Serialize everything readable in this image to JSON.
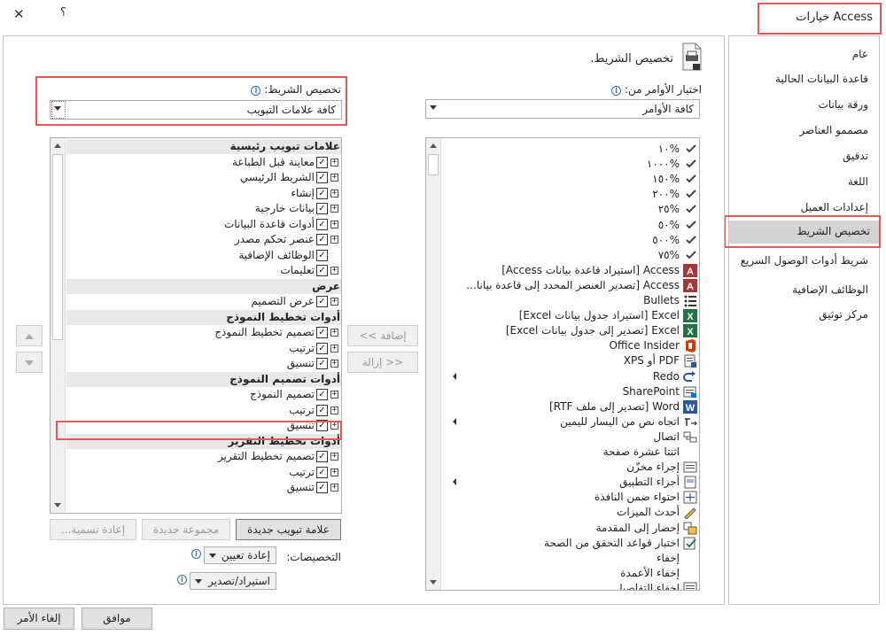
{
  "window": {
    "title": "خيارات Access",
    "help": "؟",
    "close": "✕"
  },
  "nav": {
    "items": [
      {
        "label": "عام"
      },
      {
        "label": "قاعدة البيانات الحالية"
      },
      {
        "label": "ورقة بيانات"
      },
      {
        "label": "مصممو العناصر"
      },
      {
        "label": "تدقيق"
      },
      {
        "label": "اللغة"
      },
      {
        "label": "إعدادات العميل"
      },
      {
        "label": "تخصيص الشريط"
      },
      {
        "label": "شريط أدوات الوصول السريع"
      },
      {
        "label": "الوظائف الإضافية"
      },
      {
        "label": "مركز توثيق"
      }
    ],
    "active_index": 7
  },
  "header": {
    "title": "تخصيص الشريط."
  },
  "commands": {
    "label": "اختيار الأوامر من:",
    "selected": "كافة الأوامر",
    "items": [
      {
        "text": "%١٠",
        "icon": "check-icon"
      },
      {
        "text": "%١٠٠٠",
        "icon": "check-icon"
      },
      {
        "text": "%١٥٠",
        "icon": "check-icon"
      },
      {
        "text": "%٢٠٠",
        "icon": "check-icon"
      },
      {
        "text": "%٢٥",
        "icon": "check-icon"
      },
      {
        "text": "%٥٠",
        "icon": "check-icon"
      },
      {
        "text": "%٥٠٠",
        "icon": "check-icon"
      },
      {
        "text": "%٧٥",
        "icon": "check-icon"
      },
      {
        "text": "Access [استيراد قاعدة بيانات Access]",
        "icon": "access-icon"
      },
      {
        "text": "Access [تصدير العنصر المحدد إلى قاعدة بيانا...",
        "icon": "access-icon"
      },
      {
        "text": "Bullets",
        "icon": "bullets-icon"
      },
      {
        "text": "Excel [استيراد جدول بيانات Excel]",
        "icon": "excel-icon"
      },
      {
        "text": "Excel [تصدير إلى جدول بيانات Excel]",
        "icon": "excel-icon"
      },
      {
        "text": "Office Insider",
        "icon": "office-icon"
      },
      {
        "text": "PDF أو XPS",
        "icon": "pdf-icon"
      },
      {
        "text": "Redo",
        "icon": "redo-icon",
        "submenu": true
      },
      {
        "text": "SharePoint",
        "icon": "sharepoint-icon"
      },
      {
        "text": "Word [تصدير إلى ملف RTF]",
        "icon": "word-icon"
      },
      {
        "text": "اتجاه نص من اليسار لليمين",
        "icon": "ltr-icon",
        "submenu": true
      },
      {
        "text": "اتصال",
        "icon": "connect-icon"
      },
      {
        "text": "اثنتا عشرة صفحة",
        "icon": ""
      },
      {
        "text": "إجراء مخزّن",
        "icon": "stored-proc-icon"
      },
      {
        "text": "أجزاء التطبيق",
        "icon": "app-parts-icon",
        "submenu": true
      },
      {
        "text": "احتواء ضمن النافذة",
        "icon": "fit-window-icon"
      },
      {
        "text": "أحدث الميزات",
        "icon": "new-features-icon"
      },
      {
        "text": "إحضار إلى المقدمة",
        "icon": "bring-front-icon"
      },
      {
        "text": "اختبار قواعد التحقق من الصحة",
        "icon": "validation-icon"
      },
      {
        "text": "إخفاء",
        "icon": ""
      },
      {
        "text": "إخفاء الأعمدة",
        "icon": ""
      },
      {
        "text": "إخفاء التفاصيل",
        "icon": "hide-details-icon"
      }
    ]
  },
  "ribbon": {
    "label": "تخصيص الشريط:",
    "selected": "كافة علامات التبويب",
    "items": [
      {
        "text": "علامات تبويب رئيسية",
        "type": "group"
      },
      {
        "text": "معاينة قبل الطباعة",
        "type": "tab",
        "expand": true
      },
      {
        "text": "الشريط الرئيسي",
        "type": "tab",
        "expand": true
      },
      {
        "text": "إنشاء",
        "type": "tab",
        "expand": true
      },
      {
        "text": "بيانات خارجية",
        "type": "tab",
        "expand": true
      },
      {
        "text": "أدوات قاعدة البيانات",
        "type": "tab",
        "expand": true
      },
      {
        "text": "عنصر تحكم مصدر",
        "type": "tab",
        "expand": true
      },
      {
        "text": "الوظائف الإضافية",
        "type": "tab",
        "expand": false
      },
      {
        "text": "تعليمات",
        "type": "tab",
        "expand": true
      },
      {
        "text": "عرض",
        "type": "group"
      },
      {
        "text": "عرض التصميم",
        "type": "tab",
        "expand": true
      },
      {
        "text": "أدوات تخطيط النموذج",
        "type": "group"
      },
      {
        "text": "تصميم تخطيط النموذج",
        "type": "tab",
        "expand": true
      },
      {
        "text": "ترتيب",
        "type": "tab",
        "expand": true
      },
      {
        "text": "تنسيق",
        "type": "tab",
        "expand": true
      },
      {
        "text": "أدوات تصميم النموذج",
        "type": "group"
      },
      {
        "text": "تصميم النموذج",
        "type": "tab",
        "expand": true
      },
      {
        "text": "ترتيب",
        "type": "tab",
        "expand": true
      },
      {
        "text": "تنسيق",
        "type": "tab",
        "expand": true
      },
      {
        "text": "أدوات تخطيط التقرير",
        "type": "group"
      },
      {
        "text": "تصميم تخطيط التقرير",
        "type": "tab",
        "expand": true
      },
      {
        "text": "ترتيب",
        "type": "tab",
        "expand": true
      },
      {
        "text": "تنسيق",
        "type": "tab",
        "expand": true
      }
    ]
  },
  "buttons": {
    "add": "إضافة >>",
    "remove": "<< إزالة",
    "new_tab": "علامة تبويب جديدة",
    "new_group": "مجموعة جديدة",
    "rename": "إعادة تسمية...",
    "customizations_label": "التخصيصات:",
    "reset": "إعادة تعيين",
    "import_export": "استيراد/تصدير",
    "ok": "موافق",
    "cancel": "إلغاء الأمر"
  },
  "colors": {
    "highlight_border": "#e05a5a",
    "nav_active_bg": "#d3d3d3",
    "access": "#a4373a",
    "excel": "#217346",
    "word": "#2b579a",
    "office": "#d83b01"
  }
}
